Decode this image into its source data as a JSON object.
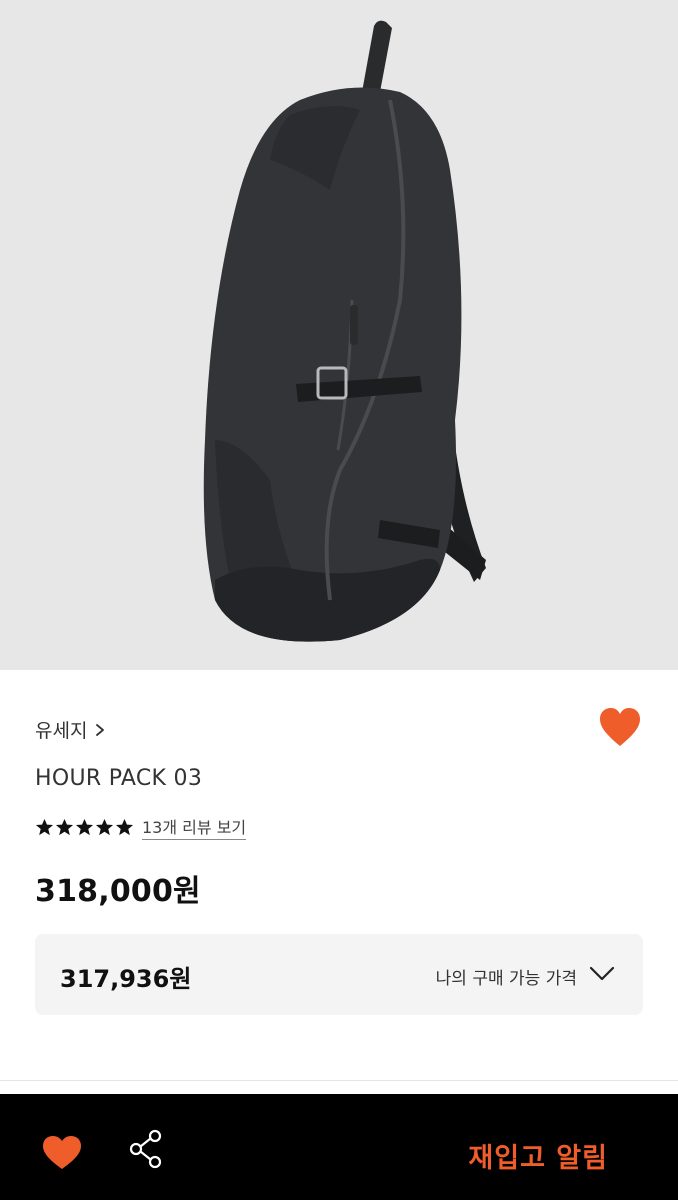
{
  "product_image": {
    "alt": "backpack-photo"
  },
  "brand": {
    "name": "유세지"
  },
  "product": {
    "name": "HOUR PACK 03"
  },
  "rating": {
    "stars": 5,
    "review_link": "13개 리뷰 보기"
  },
  "price": {
    "value": "318,000원"
  },
  "my_price": {
    "value": "317,936원",
    "label": "나의 구매 가능 가격"
  },
  "bottom_bar": {
    "restock_label": "재입고 알림"
  },
  "colors": {
    "accent": "#ef5d2b",
    "hero_bg": "#e7e7e7",
    "bottom_bar_bg": "#000000"
  }
}
